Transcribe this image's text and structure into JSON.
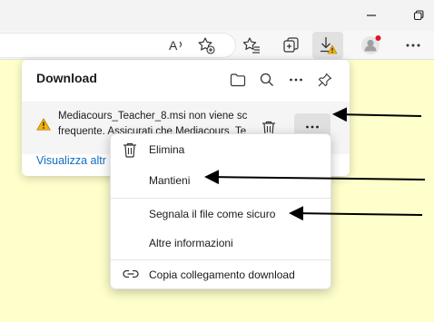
{
  "window": {
    "minimize_icon": "minimize-icon",
    "restore_icon": "restore-icon"
  },
  "toolbar": {
    "icons": [
      "read-aloud-icon",
      "add-favorite-icon",
      "favorites-icon",
      "collections-icon",
      "downloads-icon",
      "profile-avatar",
      "more-icon"
    ],
    "warning_color": "#f4b400",
    "notification_dot_color": "#e81123"
  },
  "downloads": {
    "title": "Download",
    "item": {
      "line1": "Mediacours_Teacher_8.msi non viene sc",
      "line2": "frequente. Assicurati che Mediacours_Te"
    },
    "view_more": "Visualizza altr"
  },
  "context_menu": {
    "delete": "Elimina",
    "keep": "Mantieni",
    "report_safe": "Segnala il file come sicuro",
    "more_info": "Altre informazioni",
    "copy_link": "Copia collegamento download"
  },
  "colors": {
    "page_background": "#ffffcc",
    "link": "#0f6cbd",
    "annotation_arrows": "#000000"
  }
}
